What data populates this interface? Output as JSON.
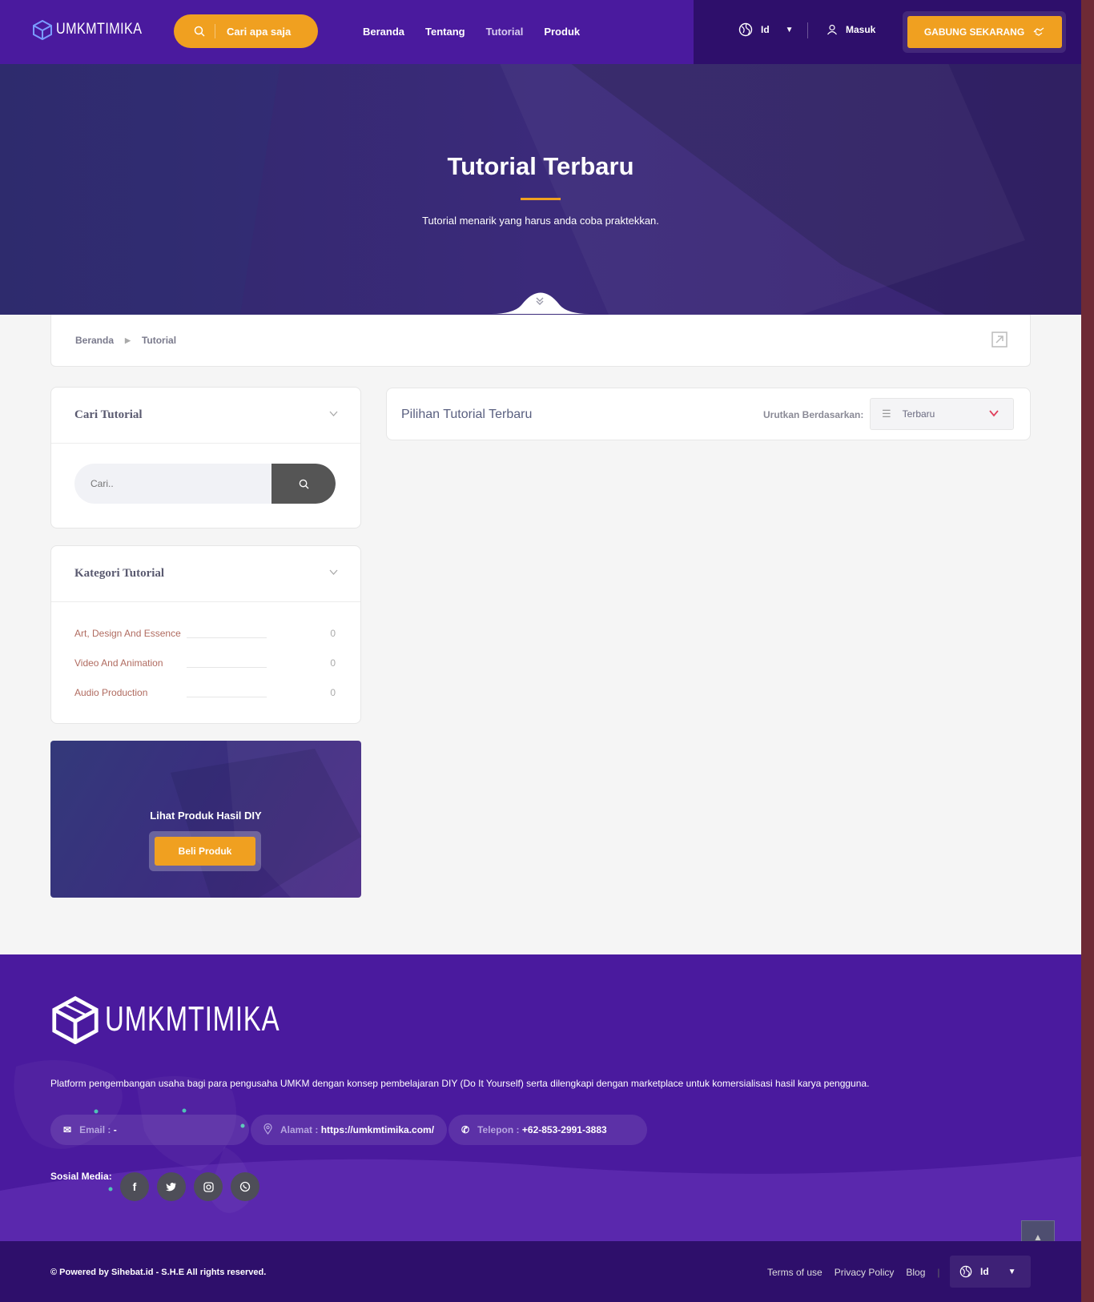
{
  "header": {
    "logo_text": "UMKMTIMIKA",
    "search_label": "Cari apa saja",
    "nav": [
      "Beranda",
      "Tentang",
      "Tutorial",
      "Produk"
    ],
    "lang": "Id",
    "login": "Masuk",
    "join_label": "GABUNG SEKARANG"
  },
  "hero": {
    "title": "Tutorial Terbaru",
    "subtitle": "Tutorial menarik yang harus anda coba praktekkan."
  },
  "breadcrumb": [
    "Beranda",
    "Tutorial"
  ],
  "sidebar": {
    "search_title": "Cari Tutorial",
    "search_placeholder": "Cari..",
    "category_title": "Kategori Tutorial",
    "categories": [
      {
        "name": "Art, Design And Essence",
        "count": "0"
      },
      {
        "name": "Video And Animation",
        "count": "0"
      },
      {
        "name": "Audio Production",
        "count": "0"
      }
    ],
    "promo_title": "Lihat Produk Hasil DIY",
    "promo_button": "Beli Produk"
  },
  "main": {
    "title": "Pilihan Tutorial Terbaru",
    "sort_label": "Urutkan Berdasarkan:",
    "sort_value": "Terbaru"
  },
  "footer": {
    "logo_text": "UMKMTIMIKA",
    "description": "Platform pengembangan usaha bagi para pengusaha UMKM dengan konsep pembelajaran DIY (Do It Yourself) serta dilengkapi dengan marketplace untuk komersialisasi hasil karya pengguna.",
    "email_label": "Email :",
    "email_value": "-",
    "address_label": "Alamat :",
    "address_value": "https://umkmtimika.com/",
    "phone_label": "Telepon :",
    "phone_value": "+62-853-2991-3883",
    "social_label": "Sosial Media:",
    "copyright": "© Powered by Sihebat.id - S.H.E All rights reserved.",
    "links": [
      "Terms of use",
      "Privacy Policy",
      "Blog"
    ],
    "lang": "Id"
  },
  "colors": {
    "primary": "#4a1a9e",
    "dark": "#2e0f6b",
    "accent": "#f0a020"
  }
}
